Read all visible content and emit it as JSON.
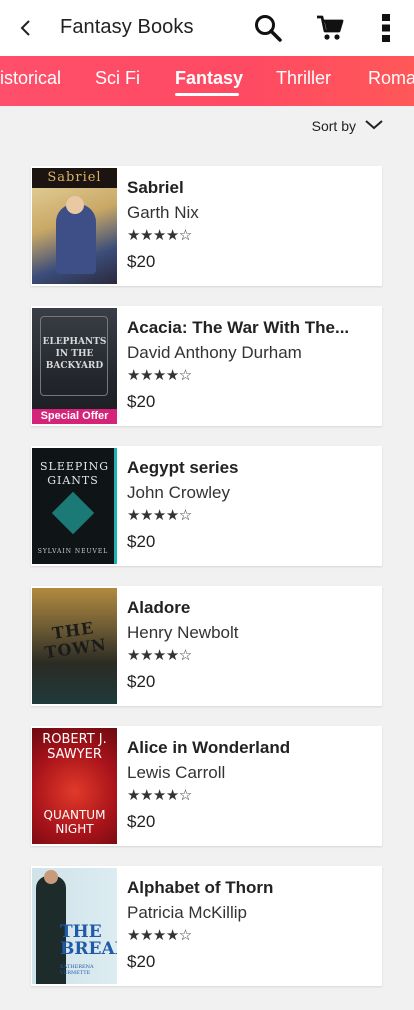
{
  "header": {
    "title": "Fantasy Books",
    "back_icon": "back-arrow-icon",
    "search_icon": "search-icon",
    "cart_icon": "cart-icon",
    "menu_icon": "more-vert-icon"
  },
  "tabs": [
    {
      "label": "Historical",
      "active": false
    },
    {
      "label": "Sci Fi",
      "active": false
    },
    {
      "label": "Fantasy",
      "active": true
    },
    {
      "label": "Thriller",
      "active": false
    },
    {
      "label": "Romance",
      "active": false
    }
  ],
  "colors": {
    "accent": "#ff4a63",
    "offer_badge": "#d6237a"
  },
  "sort": {
    "label": "Sort by",
    "icon": "chevron-down-icon"
  },
  "books": [
    {
      "title": "Sabriel",
      "author": "Garth Nix",
      "rating": "★★★★☆",
      "price": "$20",
      "badge": "",
      "cover_text": "Sabriel"
    },
    {
      "title": "Acacia: The War With The...",
      "author": "David Anthony Durham",
      "rating": "★★★★☆",
      "price": "$20",
      "badge": "Special Offer",
      "cover_text": "ELEPHANTS IN THE BACKYARD"
    },
    {
      "title": "Aegypt series",
      "author": "John Crowley",
      "rating": "★★★★☆",
      "price": "$20",
      "badge": "",
      "cover_text": "SLEEPING GIANTS",
      "cover_subtext": "SYLVAIN NEUVEL"
    },
    {
      "title": "Aladore",
      "author": "Henry Newbolt",
      "rating": "★★★★☆",
      "price": "$20",
      "badge": "",
      "cover_text": "THE TOWN"
    },
    {
      "title": "Alice in Wonderland",
      "author": "Lewis Carroll",
      "rating": "★★★★☆",
      "price": "$20",
      "badge": "",
      "cover_text": "ROBERT J. SAWYER",
      "cover_subtext": "QUANTUM NIGHT"
    },
    {
      "title": "Alphabet of Thorn",
      "author": "Patricia McKillip",
      "rating": "★★★★☆",
      "price": "$20",
      "badge": "",
      "cover_text": "THE BREAK",
      "cover_subtext": "KATHERENA VERMETTE"
    }
  ]
}
